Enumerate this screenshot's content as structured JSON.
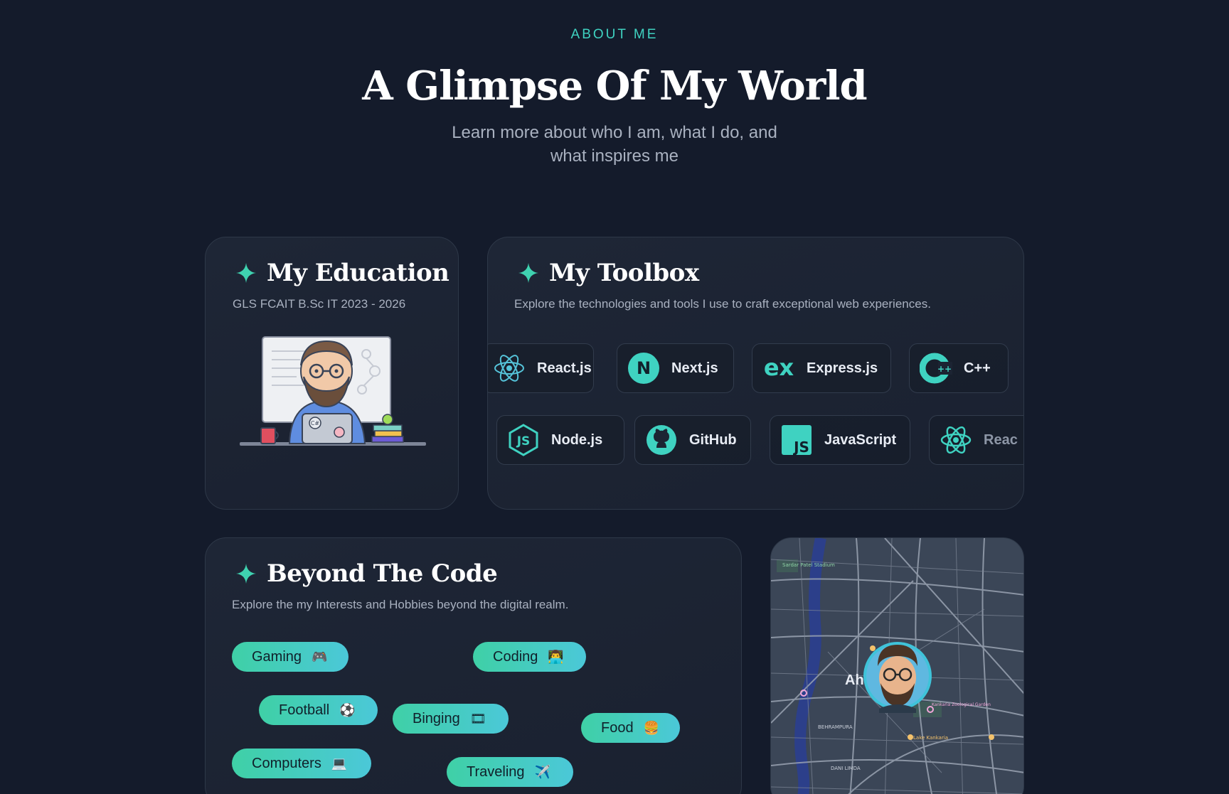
{
  "header": {
    "eyebrow": "ABOUT ME",
    "title": "A Glimpse Of My World",
    "subtitle": "Learn more about who I am, what I do, and what inspires me"
  },
  "colors": {
    "background": "#141b2b",
    "accent": "#3fd2c1",
    "chip_start": "#3fd0a6",
    "chip_end": "#4bc8d8"
  },
  "education": {
    "title": "My Education",
    "detail": "GLS FCAIT B.Sc IT 2023 - 2026",
    "laptop_sticker": "C#"
  },
  "toolbox": {
    "title": "My Toolbox",
    "description": "Explore the technologies and tools I use to craft exceptional web experiences.",
    "row1": [
      {
        "label": "React.js",
        "icon": "react-icon"
      },
      {
        "label": "Next.js",
        "icon": "nextjs-icon"
      },
      {
        "label": "Express.js",
        "icon": "express-icon"
      },
      {
        "label": "C++",
        "icon": "cplusplus-icon"
      }
    ],
    "row2": [
      {
        "label": "Node.js",
        "icon": "nodejs-icon"
      },
      {
        "label": "GitHub",
        "icon": "github-icon"
      },
      {
        "label": "JavaScript",
        "icon": "javascript-icon"
      },
      {
        "label": "Reac",
        "icon": "react-icon"
      }
    ],
    "icon_text": {
      "next": "N",
      "express": "ex",
      "cpp": "C",
      "js": "JS"
    }
  },
  "beyond": {
    "title": "Beyond The Code",
    "description": "Explore the my Interests and Hobbies beyond the digital realm.",
    "hobbies": [
      {
        "label": "Gaming",
        "emoji": "🎮"
      },
      {
        "label": "Coding",
        "emoji": "👨‍💻"
      },
      {
        "label": "Football",
        "emoji": "⚽"
      },
      {
        "label": "Binging",
        "emoji": "🎞"
      },
      {
        "label": "Food",
        "emoji": "🍔"
      },
      {
        "label": "Computers",
        "emoji": "💻"
      },
      {
        "label": "Traveling",
        "emoji": "✈️"
      }
    ]
  },
  "map": {
    "city_label": "Ah",
    "place_labels": [
      "Sardar Patel Stadium",
      "BEHRAMPURA",
      "DANI LIMDA",
      "Kankaria Zoological Garden",
      "Lake Kankaria"
    ]
  }
}
